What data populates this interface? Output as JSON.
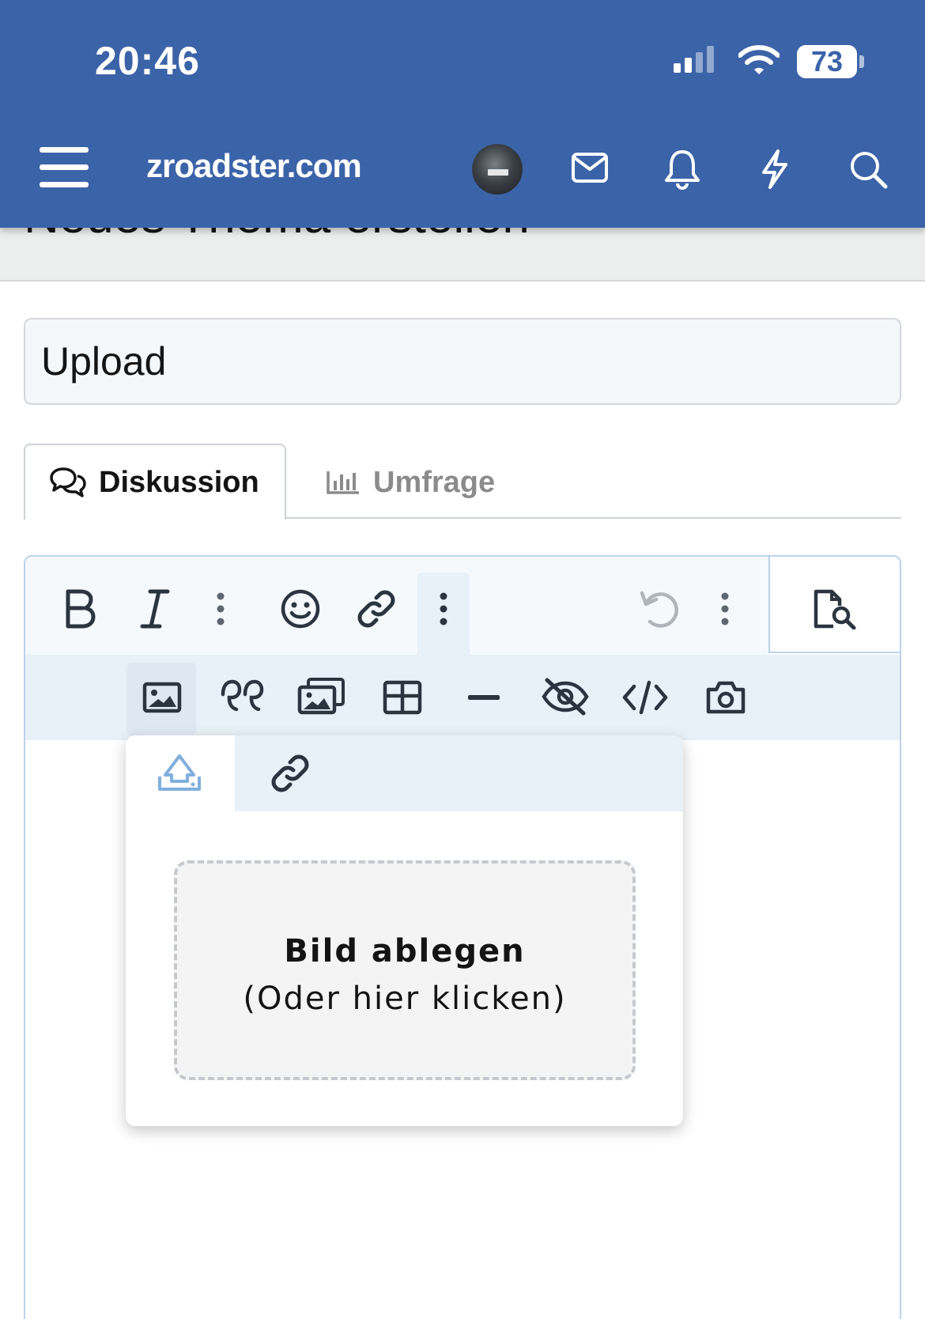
{
  "status_bar": {
    "time": "20:46",
    "battery_level": "73",
    "battery_percent": 73
  },
  "header": {
    "site_name": "zroadster.com",
    "icons": [
      "menu-icon",
      "avatar",
      "mail-icon",
      "bell-icon",
      "bolt-icon",
      "search-icon"
    ],
    "background_color": "#3b63a8"
  },
  "page": {
    "title": "Neues Thema erstellen"
  },
  "form": {
    "title_value": "Upload"
  },
  "tabs": [
    {
      "label": "Diskussion",
      "icon": "comments-icon",
      "active": true
    },
    {
      "label": "Umfrage",
      "icon": "chart-icon",
      "active": false
    }
  ],
  "editor": {
    "toolbar_row1": [
      "bold-icon",
      "italic-icon",
      "more-text-icon",
      "smiley-icon",
      "link-icon",
      "more-insert-icon",
      "undo-icon",
      "more-icon",
      "preview-icon"
    ],
    "toolbar_row2": [
      "image-icon",
      "quote-icon",
      "gallery-icon",
      "table-icon",
      "horizontal-rule-icon",
      "spoiler-icon",
      "code-icon",
      "camera-icon"
    ]
  },
  "image_popup": {
    "tabs": [
      "upload-icon",
      "link-icon"
    ],
    "drop_title": "Bild ablegen",
    "drop_subtitle": "(Oder hier klicken)"
  }
}
